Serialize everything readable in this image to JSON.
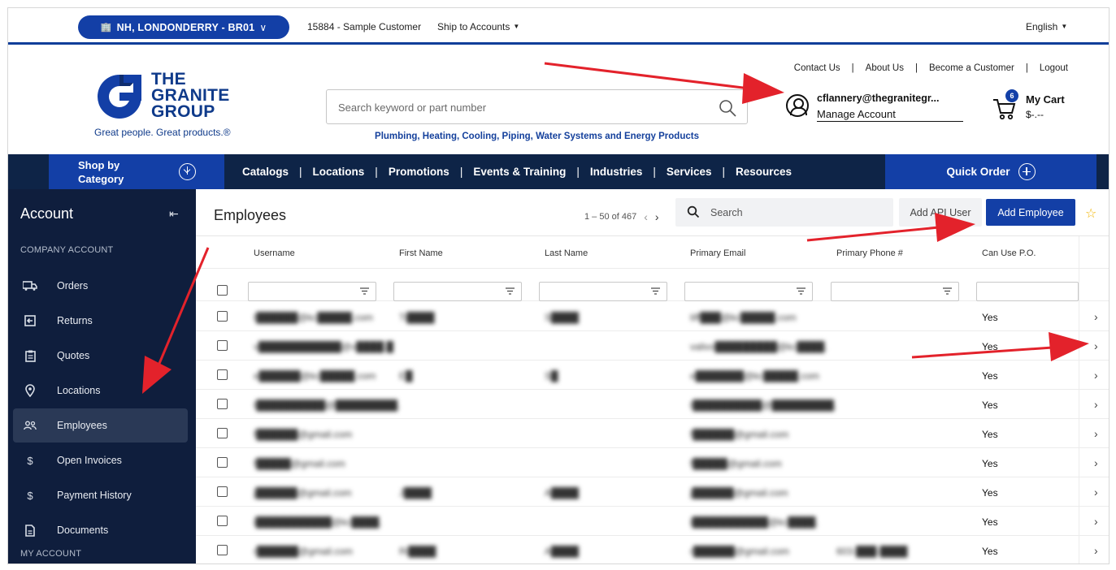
{
  "utility": {
    "branch": "NH, LONDONDERRY - BR01",
    "customer": "15884 - Sample Customer",
    "ship_to": "Ship to Accounts",
    "language": "English"
  },
  "header": {
    "logo_line1": "THE",
    "logo_line2": "GRANITE",
    "logo_line3": "GROUP",
    "logo_tagline": "Great people. Great products.®",
    "search_placeholder": "Search keyword or part number",
    "tagline": "Plumbing, Heating, Cooling, Piping, Water Systems and Energy Products",
    "links": [
      "Contact Us",
      "About Us",
      "Become a Customer",
      "Logout"
    ],
    "account_email": "cflannery@thegranitegr...",
    "account_manage": "Manage Account",
    "cart_count": "6",
    "cart_label": "My Cart",
    "cart_total": "$-.--"
  },
  "nav": {
    "shop_line1": "Shop by",
    "shop_line2": "Category",
    "links": [
      "Catalogs",
      "Locations",
      "Promotions",
      "Events & Training",
      "Industries",
      "Services",
      "Resources"
    ],
    "quick_order": "Quick Order"
  },
  "sidebar": {
    "title": "Account",
    "section_company": "COMPANY ACCOUNT",
    "items": [
      {
        "label": "Orders",
        "icon": "truck-icon"
      },
      {
        "label": "Returns",
        "icon": "return-icon"
      },
      {
        "label": "Quotes",
        "icon": "clipboard-icon"
      },
      {
        "label": "Locations",
        "icon": "map-pin-icon"
      },
      {
        "label": "Employees",
        "icon": "people-icon"
      },
      {
        "label": "Open Invoices",
        "icon": "dollar-icon"
      },
      {
        "label": "Payment History",
        "icon": "dollar-icon"
      },
      {
        "label": "Documents",
        "icon": "document-icon"
      }
    ],
    "section_my": "MY ACCOUNT"
  },
  "content": {
    "title": "Employees",
    "pager": "1 – 50 of 467",
    "search_placeholder": "Search",
    "add_api_user": "Add API User",
    "add_employee": "Add Employee",
    "columns": [
      "Username",
      "First Name",
      "Last Name",
      "Primary Email",
      "Primary Phone #",
      "Can Use P.O."
    ],
    "rows": [
      {
        "username": "t██████@kc█████.com",
        "first": "Ti████",
        "last": "S████",
        "email": "tiff███@kc█████.com",
        "phone": "",
        "po": "Yes"
      },
      {
        "username": "v████████████@v████.█",
        "first": "",
        "last": "",
        "email": "valivo█████████@kc████.",
        "phone": "",
        "po": "Yes"
      },
      {
        "username": "e██████@kc█████.com",
        "first": "E█",
        "last": "S█",
        "email": "e███████@kc█████.com",
        "phone": "",
        "po": "Yes"
      },
      {
        "username": "t██████████@█████████.",
        "first": "",
        "last": "",
        "email": "t██████████@█████████.",
        "phone": "",
        "po": "Yes"
      },
      {
        "username": "f██████@gmail.com",
        "first": "",
        "last": "",
        "email": "f██████@gmail.com",
        "phone": "",
        "po": "Yes"
      },
      {
        "username": "f█████@gmail.com",
        "first": "",
        "last": "",
        "email": "f█████@gmail.com",
        "phone": "",
        "po": "Yes"
      },
      {
        "username": "j██████@gmail.com",
        "first": "J████",
        "last": "A████",
        "email": "j██████@gmail.com",
        "phone": "",
        "po": "Yes"
      },
      {
        "username": "i███████████@kc████.",
        "first": "",
        "last": "",
        "email": "i███████████@kc████.",
        "phone": "",
        "po": "Yes"
      },
      {
        "username": "r██████@gmail.com",
        "first": "Ri████",
        "last": "A████",
        "email": "r██████@gmail.com",
        "phone": "603-███-████",
        "po": "Yes"
      }
    ]
  },
  "colors": {
    "brand_blue": "#133fa6",
    "navy": "#0e2447",
    "sidebar": "#0f1e3d",
    "arrow_red": "#e3222b",
    "star": "#f2b400"
  }
}
